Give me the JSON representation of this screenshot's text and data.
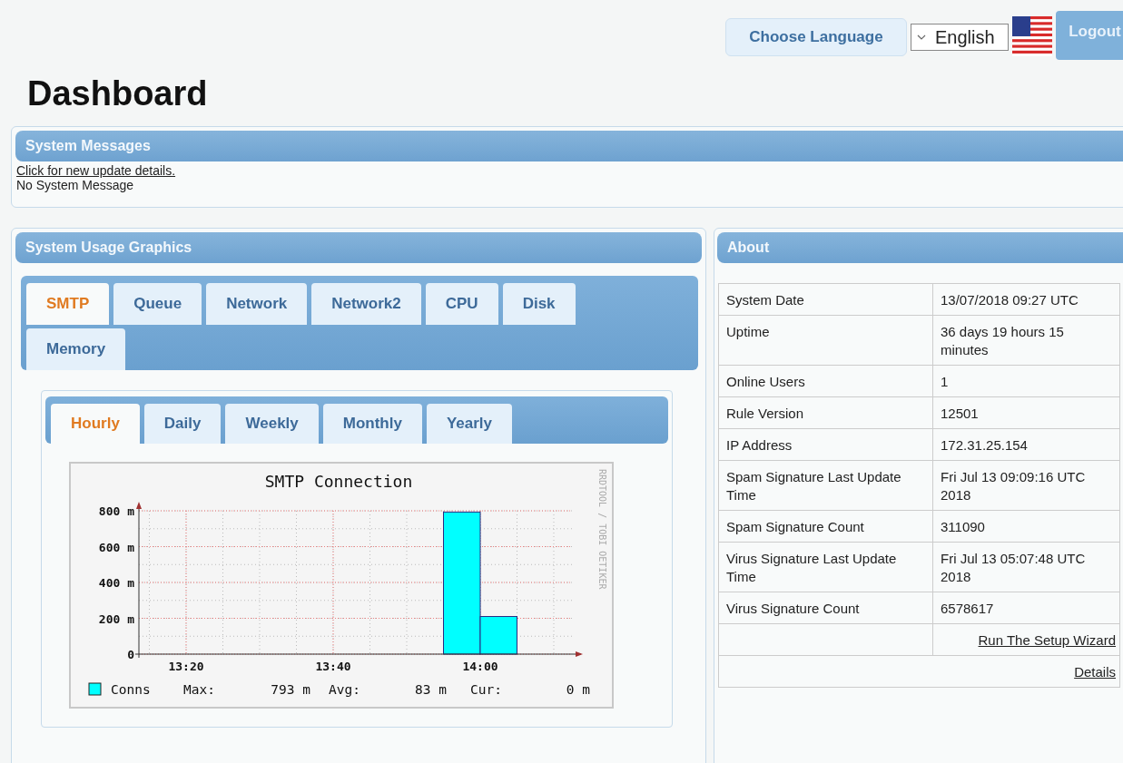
{
  "header": {
    "choose_language": "Choose Language",
    "language": "English",
    "logout": "Logout"
  },
  "title": "Dashboard",
  "system_messages": {
    "title": "System Messages",
    "link": "Click for new update details.",
    "message": "No System Message"
  },
  "usage": {
    "title": "System Usage Graphics",
    "tabs": [
      {
        "label": "SMTP",
        "selected": true
      },
      {
        "label": "Queue",
        "selected": false
      },
      {
        "label": "Network",
        "selected": false
      },
      {
        "label": "Network2",
        "selected": false
      },
      {
        "label": "CPU",
        "selected": false
      },
      {
        "label": "Disk",
        "selected": false
      },
      {
        "label": "Memory",
        "selected": false
      }
    ],
    "periods": [
      {
        "label": "Hourly",
        "selected": true
      },
      {
        "label": "Daily",
        "selected": false
      },
      {
        "label": "Weekly",
        "selected": false
      },
      {
        "label": "Monthly",
        "selected": false
      },
      {
        "label": "Yearly",
        "selected": false
      }
    ],
    "graph": {
      "credit": "RRDTOOL / TOBI OETIKER",
      "legend": {
        "max_label": "Max:",
        "max": "793 m",
        "avg_label": "Avg:",
        "avg": "83 m",
        "cur_label": "Cur:",
        "cur": "0 m"
      },
      "chart_data": {
        "type": "bar",
        "title": "SMTP Connection",
        "grid": true,
        "categories": [
          null,
          "13:20",
          null,
          null,
          null,
          "13:40",
          null,
          null,
          null,
          "14:00",
          null
        ],
        "series": [
          {
            "name": "Conns",
            "color": "#00ffff",
            "values": [
              null,
              null,
              null,
              null,
              null,
              null,
              null,
              null,
              793,
              210,
              null
            ]
          }
        ],
        "ylim": [
          0,
          800
        ],
        "yticks": [
          {
            "value": 0,
            "label": "0"
          },
          {
            "value": 200,
            "label": "200 m"
          },
          {
            "value": 400,
            "label": "400 m"
          },
          {
            "value": 600,
            "label": "600 m"
          },
          {
            "value": 800,
            "label": "800 m"
          }
        ]
      }
    }
  },
  "about": {
    "title": "About",
    "rows": [
      {
        "label": "System Date",
        "value": "13/07/2018 09:27 UTC"
      },
      {
        "label": "Uptime",
        "value": "36 days 19 hours 15 minutes"
      },
      {
        "label": "Online Users",
        "value": "1"
      },
      {
        "label": "Rule Version",
        "value": "12501"
      },
      {
        "label": "IP Address",
        "value": "172.31.25.154"
      },
      {
        "label": "Spam Signature Last Update Time",
        "value": "Fri Jul 13 09:09:16 UTC 2018"
      },
      {
        "label": "Spam Signature Count",
        "value": "311090"
      },
      {
        "label": "Virus Signature Last Update Time",
        "value": "Fri Jul 13 05:07:48 UTC 2018"
      },
      {
        "label": "Virus Signature Count",
        "value": "6578617"
      }
    ],
    "wizard_link": "Run The Setup Wizard",
    "details_link": "Details"
  }
}
